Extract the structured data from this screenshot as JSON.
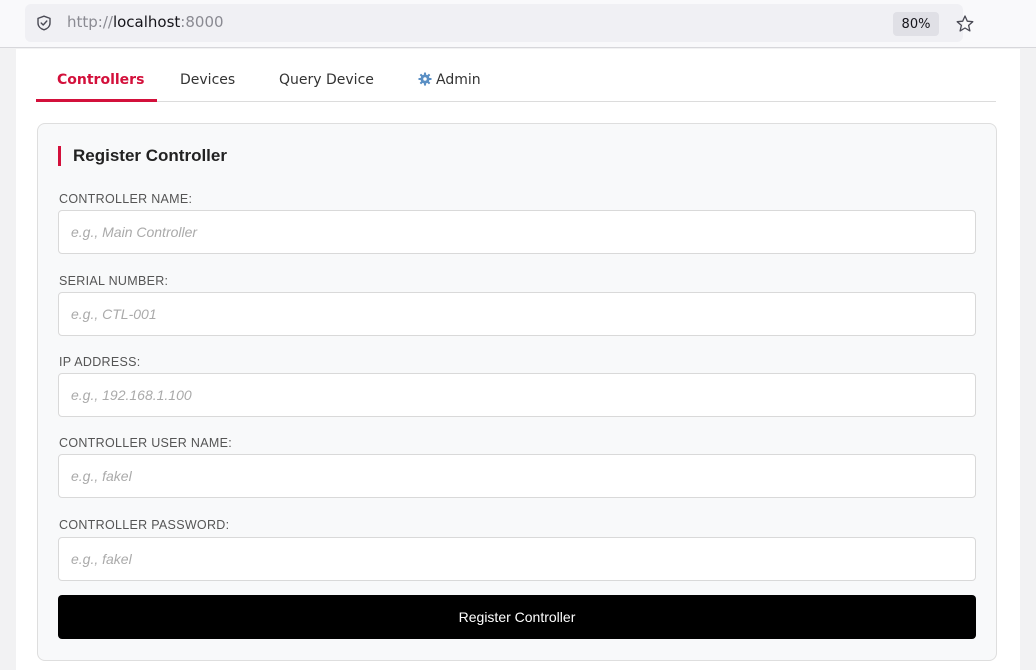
{
  "browser": {
    "url_scheme": "http://",
    "url_host": "localhost",
    "url_port": ":8000",
    "zoom": "80%",
    "icons": {
      "site": "shield-icon",
      "bookmark": "star-icon"
    }
  },
  "tabs": [
    {
      "label": "Controllers",
      "active": true
    },
    {
      "label": "Devices",
      "active": false
    },
    {
      "label": "Query Device",
      "active": false
    },
    {
      "label": "Admin",
      "active": false,
      "icon": "gear-icon"
    }
  ],
  "form": {
    "title": "Register Controller",
    "fields": [
      {
        "label": "CONTROLLER NAME:",
        "placeholder": "e.g., Main Controller",
        "value": ""
      },
      {
        "label": "SERIAL NUMBER:",
        "placeholder": "e.g., CTL-001",
        "value": ""
      },
      {
        "label": "IP ADDRESS:",
        "placeholder": "e.g., 192.168.1.100",
        "value": ""
      },
      {
        "label": "CONTROLLER USER NAME:",
        "placeholder": "e.g., fakel",
        "value": ""
      },
      {
        "label": "CONTROLLER PASSWORD:",
        "placeholder": "e.g., fakel",
        "value": ""
      }
    ],
    "submit_label": "Register Controller"
  },
  "colors": {
    "accent": "#d3103b",
    "button": "#000000"
  }
}
